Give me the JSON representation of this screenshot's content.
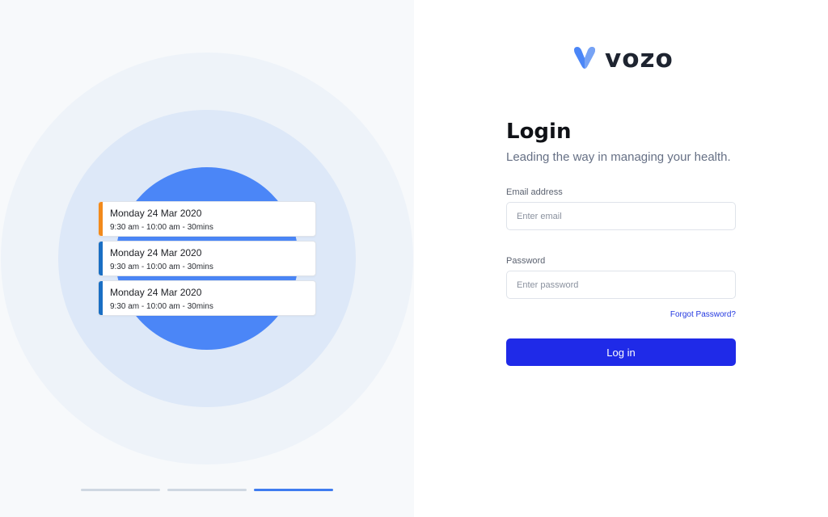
{
  "brand": {
    "name": "vozo"
  },
  "appointments": [
    {
      "date": "Monday 24 Mar 2020",
      "time": "9:30 am - 10:00 am - 30mins",
      "accent": "#f28a1c"
    },
    {
      "date": "Monday 24 Mar 2020",
      "time": "9:30 am - 10:00 am - 30mins",
      "accent": "#1a6fc4"
    },
    {
      "date": "Monday 24 Mar 2020",
      "time": "9:30 am - 10:00 am - 30mins",
      "accent": "#1a6fc4"
    }
  ],
  "carousel": {
    "count": 3,
    "active_index": 2
  },
  "login": {
    "title": "Login",
    "subtitle": "Leading the way in managing your health.",
    "email_label": "Email address",
    "email_placeholder": "Enter email",
    "password_label": "Password",
    "password_placeholder": "Enter password",
    "forgot_label": "Forgot Password?",
    "submit_label": "Log in"
  },
  "colors": {
    "primary": "#1f2ae8",
    "circle": "#4b86f7",
    "link": "#2338e0"
  },
  "icons": {
    "logo": "vozo-v-logo-icon"
  }
}
